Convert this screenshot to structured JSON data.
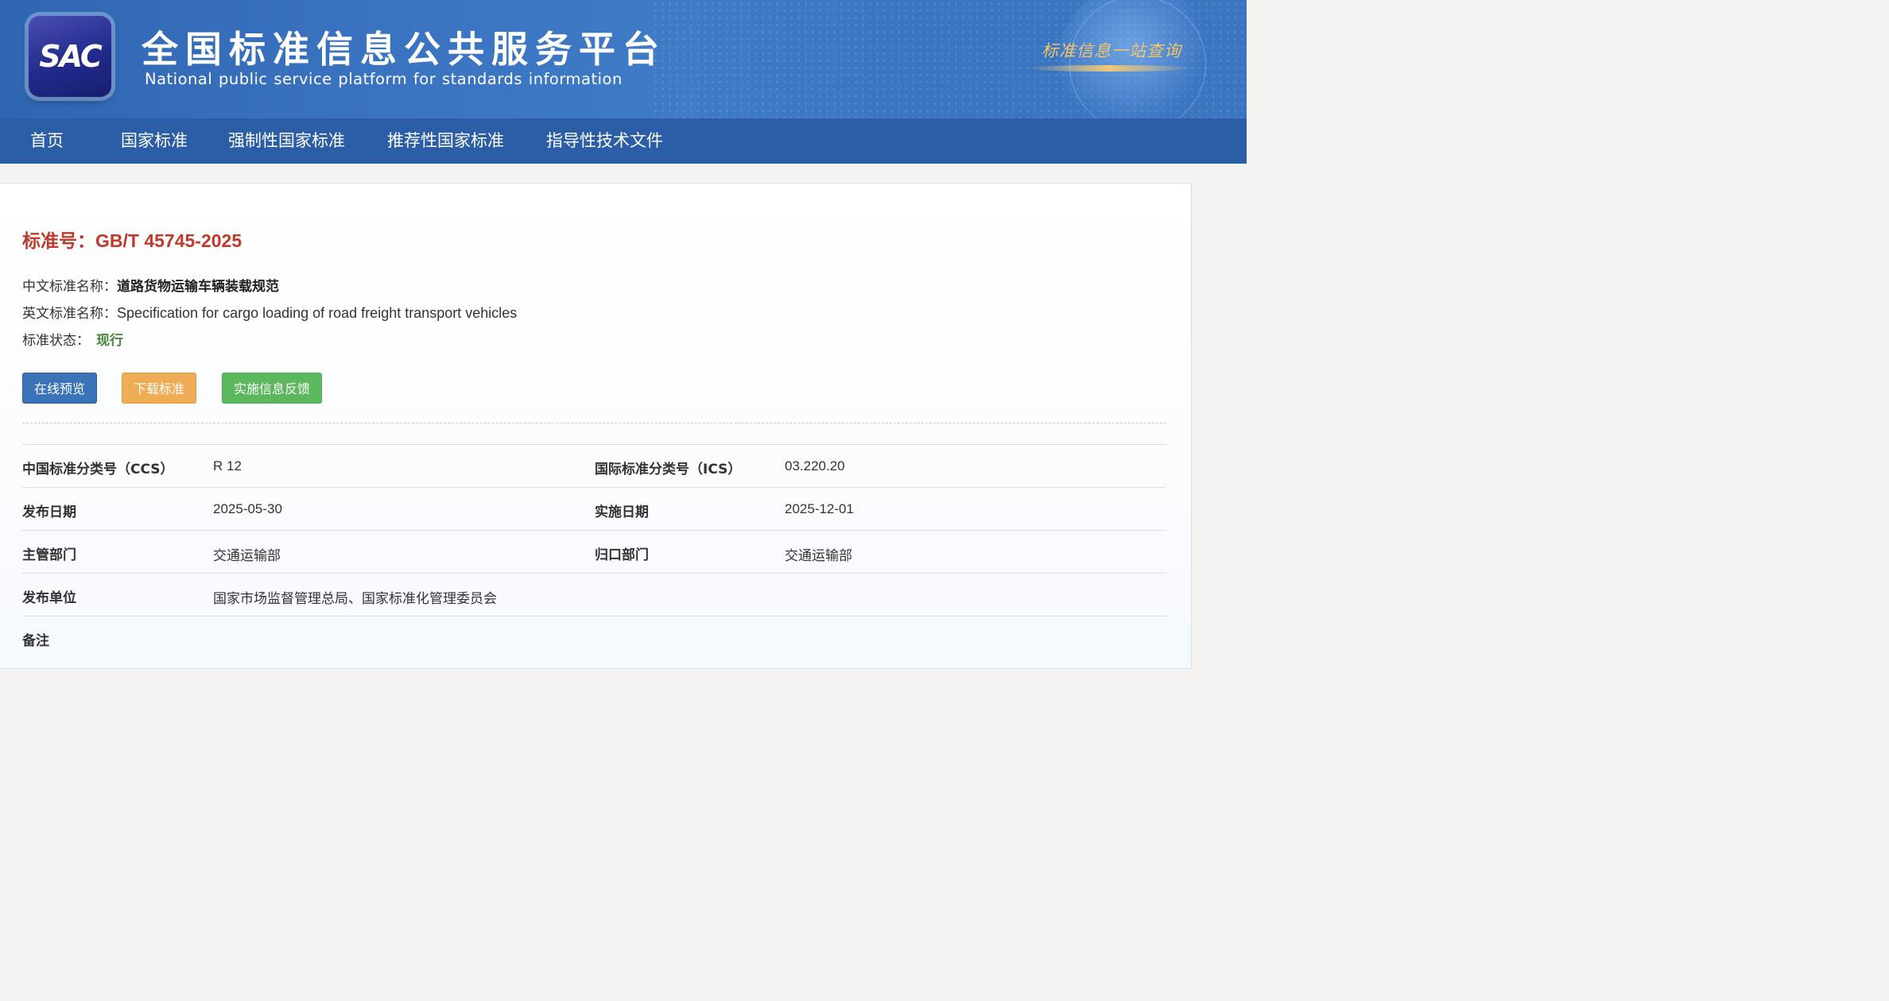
{
  "header": {
    "logo_text": "SAC",
    "title": "全国标准信息公共服务平台",
    "subtitle": "National public service platform  for standards information",
    "slogan": "标准信息一站查询"
  },
  "nav": {
    "items": [
      {
        "label": "首页"
      },
      {
        "label": "国家标准"
      },
      {
        "label": "强制性国家标准"
      },
      {
        "label": "推荐性国家标准"
      },
      {
        "label": "指导性技术文件"
      }
    ]
  },
  "standard": {
    "number_label": "标准号：",
    "number": "GB/T 45745-2025",
    "cn_name_label": "中文标准名称：",
    "cn_name": "道路货物运输车辆装载规范",
    "en_name_label": "英文标准名称：",
    "en_name": "Specification for cargo loading of road freight transport vehicles",
    "status_label": "标准状态：",
    "status": "现行"
  },
  "actions": {
    "preview": "在线预览",
    "download": "下载标准",
    "feedback": "实施信息反馈"
  },
  "details": {
    "ccs_label": "中国标准分类号（CCS）",
    "ccs_value": "R 12",
    "ics_label": "国际标准分类号（ICS）",
    "ics_value": "03.220.20",
    "publish_date_label": "发布日期",
    "publish_date": "2025-05-30",
    "implement_date_label": "实施日期",
    "implement_date": "2025-12-01",
    "competent_dept_label": "主管部门",
    "competent_dept": "交通运输部",
    "centralized_dept_label": "归口部门",
    "centralized_dept": "交通运输部",
    "publisher_label": "发布单位",
    "publisher": "国家市场监督管理总局、国家标准化管理委员会",
    "remarks_label": "备注"
  },
  "colors": {
    "banner": "#3a73c0",
    "nav": "#2b5ea6",
    "standard_no": "#c0392b",
    "status": "#4a8a3a",
    "btn_preview": "#3a73b8",
    "btn_download": "#eeac55",
    "btn_feedback": "#5cb85c"
  }
}
